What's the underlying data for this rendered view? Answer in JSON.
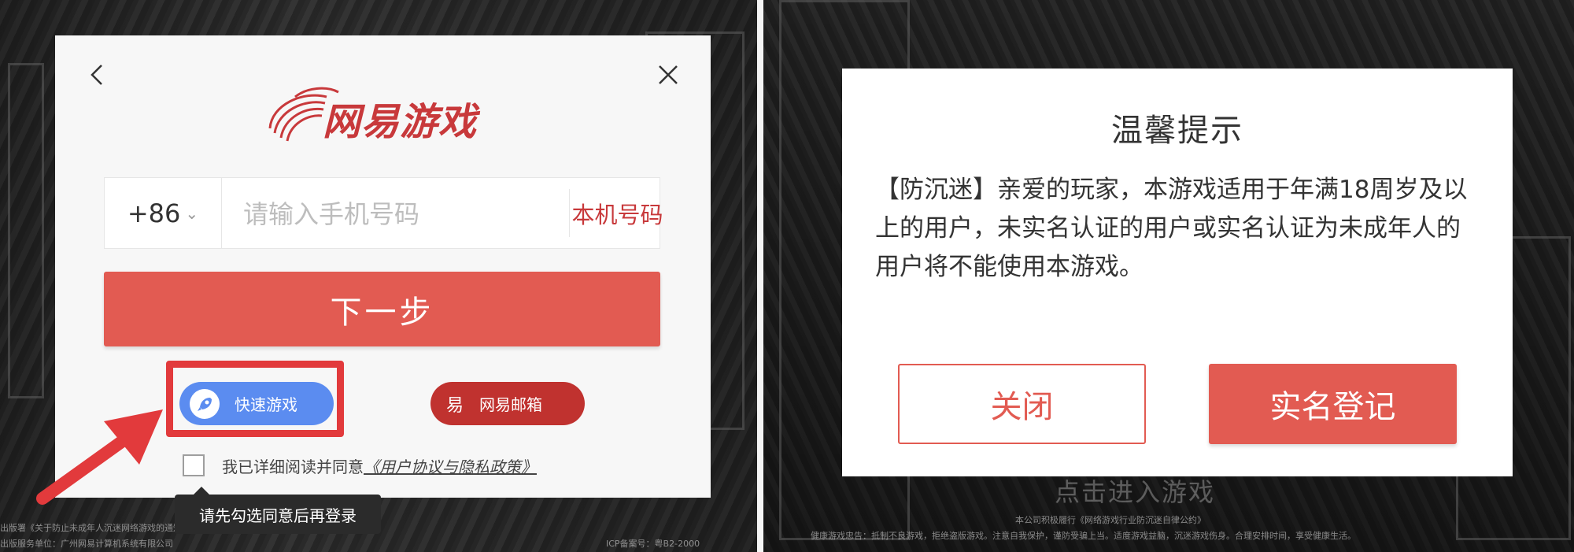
{
  "login_dialog": {
    "logo_text": "网易游戏",
    "country_code": "+86",
    "phone_placeholder": "请输入手机号码",
    "local_number_label": "本机号码",
    "next_label": "下一步",
    "quick_game_label": "快速游戏",
    "netease_mail_label": "网易邮箱",
    "netease_mail_icon_glyph": "易",
    "agree_prefix": "我已详细阅读并同意",
    "agree_link": "《用户协议与隐私政策》",
    "tooltip": "请先勾选同意后再登录"
  },
  "tip_dialog": {
    "title": "温馨提示",
    "body": "【防沉迷】亲爱的玩家，本游戏适用于年满18周岁及以上的用户，未实名认证的用户或实名认证为未成年人的用户将不能使用本游戏。",
    "close_label": "关闭",
    "register_label": "实名登记"
  },
  "background": {
    "enter_game": "点击进入游戏",
    "left_footer_1": "出版署《关于防止未成年人沉迷网络游戏的通知》",
    "left_footer_2": "出版服务单位：广州网易计算机系统有限公司",
    "left_footer_3": "ICP备案号：粤B2-2000",
    "right_footer_1": "本公司积极履行《网络游戏行业防沉迷自律公约》",
    "right_footer_2": "健康游戏忠告：抵制不良游戏，拒绝盗版游戏。注意自我保护，谨防受骗上当。适度游戏益脑，沉迷游戏伤身。合理安排时间，享受健康生活。"
  },
  "colors": {
    "brand_red": "#e25b52",
    "logo_red": "#c8393b",
    "quick_blue": "#5b8cf0",
    "highlight_red": "#e23a3c"
  }
}
